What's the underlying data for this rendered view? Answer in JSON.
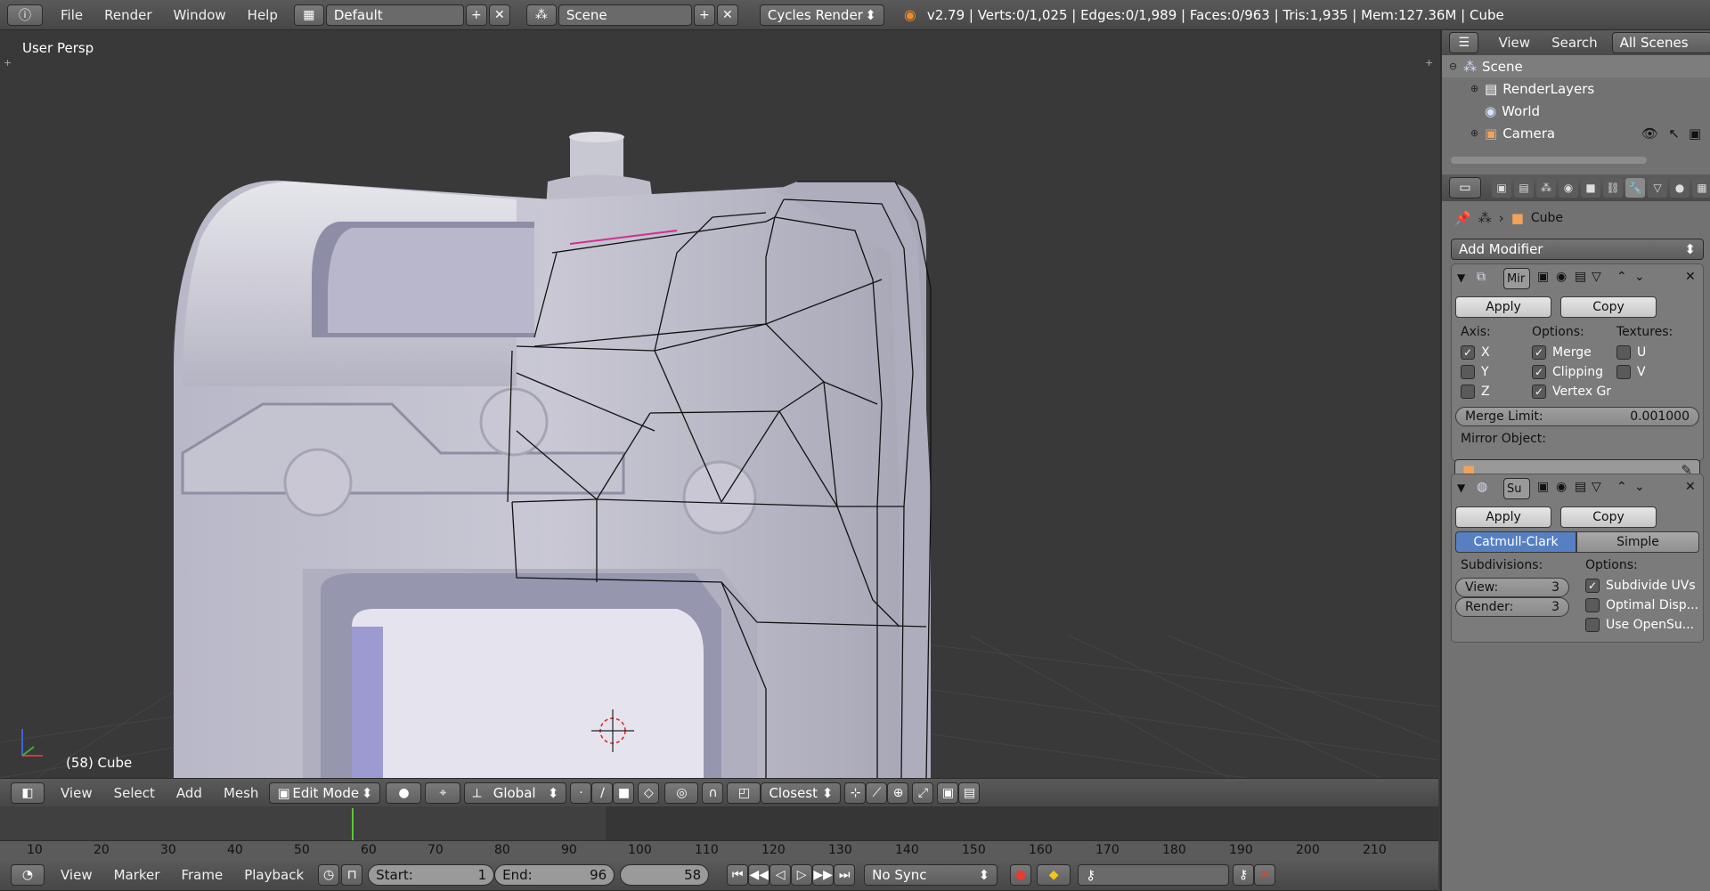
{
  "topbar": {
    "menus": [
      "File",
      "Render",
      "Window",
      "Help"
    ],
    "layout": "Default",
    "scene": "Scene",
    "engine": "Cycles Render",
    "stats": "v2.79 | Verts:0/1,025 | Edges:0/1,989 | Faces:0/963 | Tris:1,935 | Mem:127.36M | Cube"
  },
  "viewport": {
    "view_name": "User Persp",
    "object_label": "(58) Cube"
  },
  "viewport_header": {
    "menus": [
      "View",
      "Select",
      "Add",
      "Mesh"
    ],
    "mode": "Edit Mode",
    "orientation": "Global",
    "snap": "Closest"
  },
  "outliner": {
    "menus": [
      "View",
      "Search"
    ],
    "filter": "All Scenes",
    "items": [
      {
        "label": "Scene",
        "icon": "scene-icon"
      },
      {
        "label": "RenderLayers",
        "icon": "renderlayers-icon"
      },
      {
        "label": "World",
        "icon": "world-icon"
      },
      {
        "label": "Camera",
        "icon": "camera-icon"
      }
    ]
  },
  "properties": {
    "object_name": "Cube",
    "add_modifier": "Add Modifier",
    "mirror": {
      "name": "Mir",
      "apply": "Apply",
      "copy": "Copy",
      "axis_label": "Axis:",
      "options_label": "Options:",
      "textures_label": "Textures:",
      "axis": [
        {
          "label": "X",
          "checked": true
        },
        {
          "label": "Y",
          "checked": false
        },
        {
          "label": "Z",
          "checked": false
        }
      ],
      "options": [
        {
          "label": "Merge",
          "checked": true
        },
        {
          "label": "Clipping",
          "checked": true
        },
        {
          "label": "Vertex Gr",
          "checked": true
        }
      ],
      "textures": [
        {
          "label": "U",
          "checked": false
        },
        {
          "label": "V",
          "checked": false
        }
      ],
      "merge_limit_label": "Merge Limit:",
      "merge_limit_value": "0.001000",
      "mirror_object_label": "Mirror Object:"
    },
    "subsurf": {
      "name": "Su",
      "apply": "Apply",
      "copy": "Copy",
      "tab_catmull": "Catmull-Clark",
      "tab_simple": "Simple",
      "subdivisions_label": "Subdivisions:",
      "options_label": "Options:",
      "view_label": "View:",
      "view_value": "3",
      "render_label": "Render:",
      "render_value": "3",
      "options": [
        {
          "label": "Subdivide UVs",
          "checked": true
        },
        {
          "label": "Optimal Disp...",
          "checked": false
        },
        {
          "label": "Use OpenSu...",
          "checked": false
        }
      ]
    }
  },
  "timeline": {
    "ticks": [
      "10",
      "20",
      "30",
      "40",
      "50",
      "60",
      "70",
      "80",
      "90",
      "100",
      "110",
      "120",
      "130",
      "140",
      "150",
      "160",
      "170",
      "180",
      "190",
      "200",
      "210"
    ],
    "current_frame": 58,
    "menus": [
      "View",
      "Marker",
      "Frame",
      "Playback"
    ],
    "start_label": "Start:",
    "start_value": "1",
    "end_label": "End:",
    "end_value": "96",
    "current_value": "58",
    "sync": "No Sync"
  },
  "colors": {
    "accent_blue": "#5680c2",
    "selected_edge": "#d03090",
    "frame_marker": "#59c83a"
  }
}
